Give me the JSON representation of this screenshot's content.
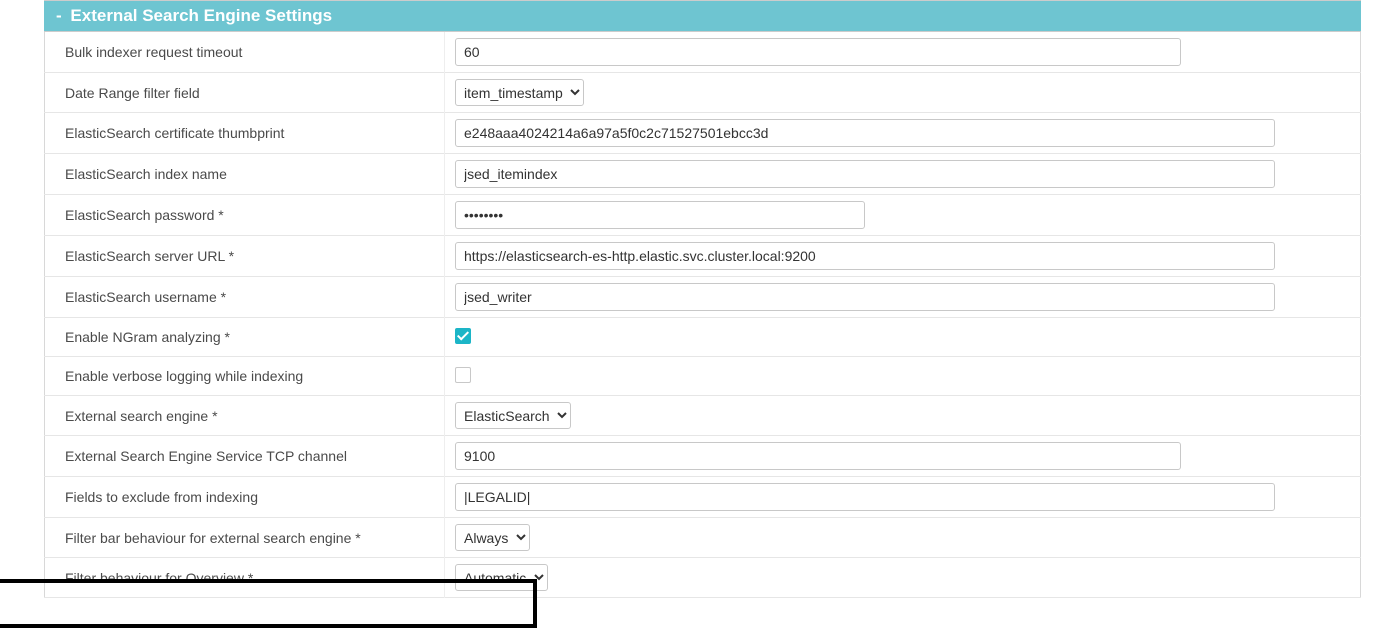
{
  "section": {
    "collapse_indicator": "-",
    "title": "External Search Engine Settings"
  },
  "settings": {
    "bulk_timeout": {
      "label": "Bulk indexer request timeout",
      "value": "60"
    },
    "date_range_field": {
      "label": "Date Range filter field",
      "value": "item_timestamp"
    },
    "es_cert_thumb": {
      "label": "ElasticSearch certificate thumbprint",
      "value": "e248aaa4024214a6a97a5f0c2c71527501ebcc3d"
    },
    "es_index_name": {
      "label": "ElasticSearch index name",
      "value": "jsed_itemindex"
    },
    "es_password": {
      "label": "ElasticSearch password *",
      "value": "••••••••"
    },
    "es_server_url": {
      "label": "ElasticSearch server URL *",
      "value": "https://elasticsearch-es-http.elastic.svc.cluster.local:9200"
    },
    "es_username": {
      "label": "ElasticSearch username *",
      "value": "jsed_writer"
    },
    "enable_ngram": {
      "label": "Enable NGram analyzing *",
      "checked": true
    },
    "enable_verbose": {
      "label": "Enable verbose logging while indexing",
      "checked": false
    },
    "ext_engine": {
      "label": "External search engine *",
      "value": "ElasticSearch"
    },
    "tcp_channel": {
      "label": "External Search Engine Service TCP channel",
      "value": "9100"
    },
    "exclude_fields": {
      "label": "Fields to exclude from indexing",
      "value": "|LEGALID|"
    },
    "filter_bar": {
      "label": "Filter bar behaviour for external search engine *",
      "value": "Always"
    },
    "filter_overview": {
      "label": "Filter behaviour for Overview *",
      "value": "Automatic"
    }
  }
}
